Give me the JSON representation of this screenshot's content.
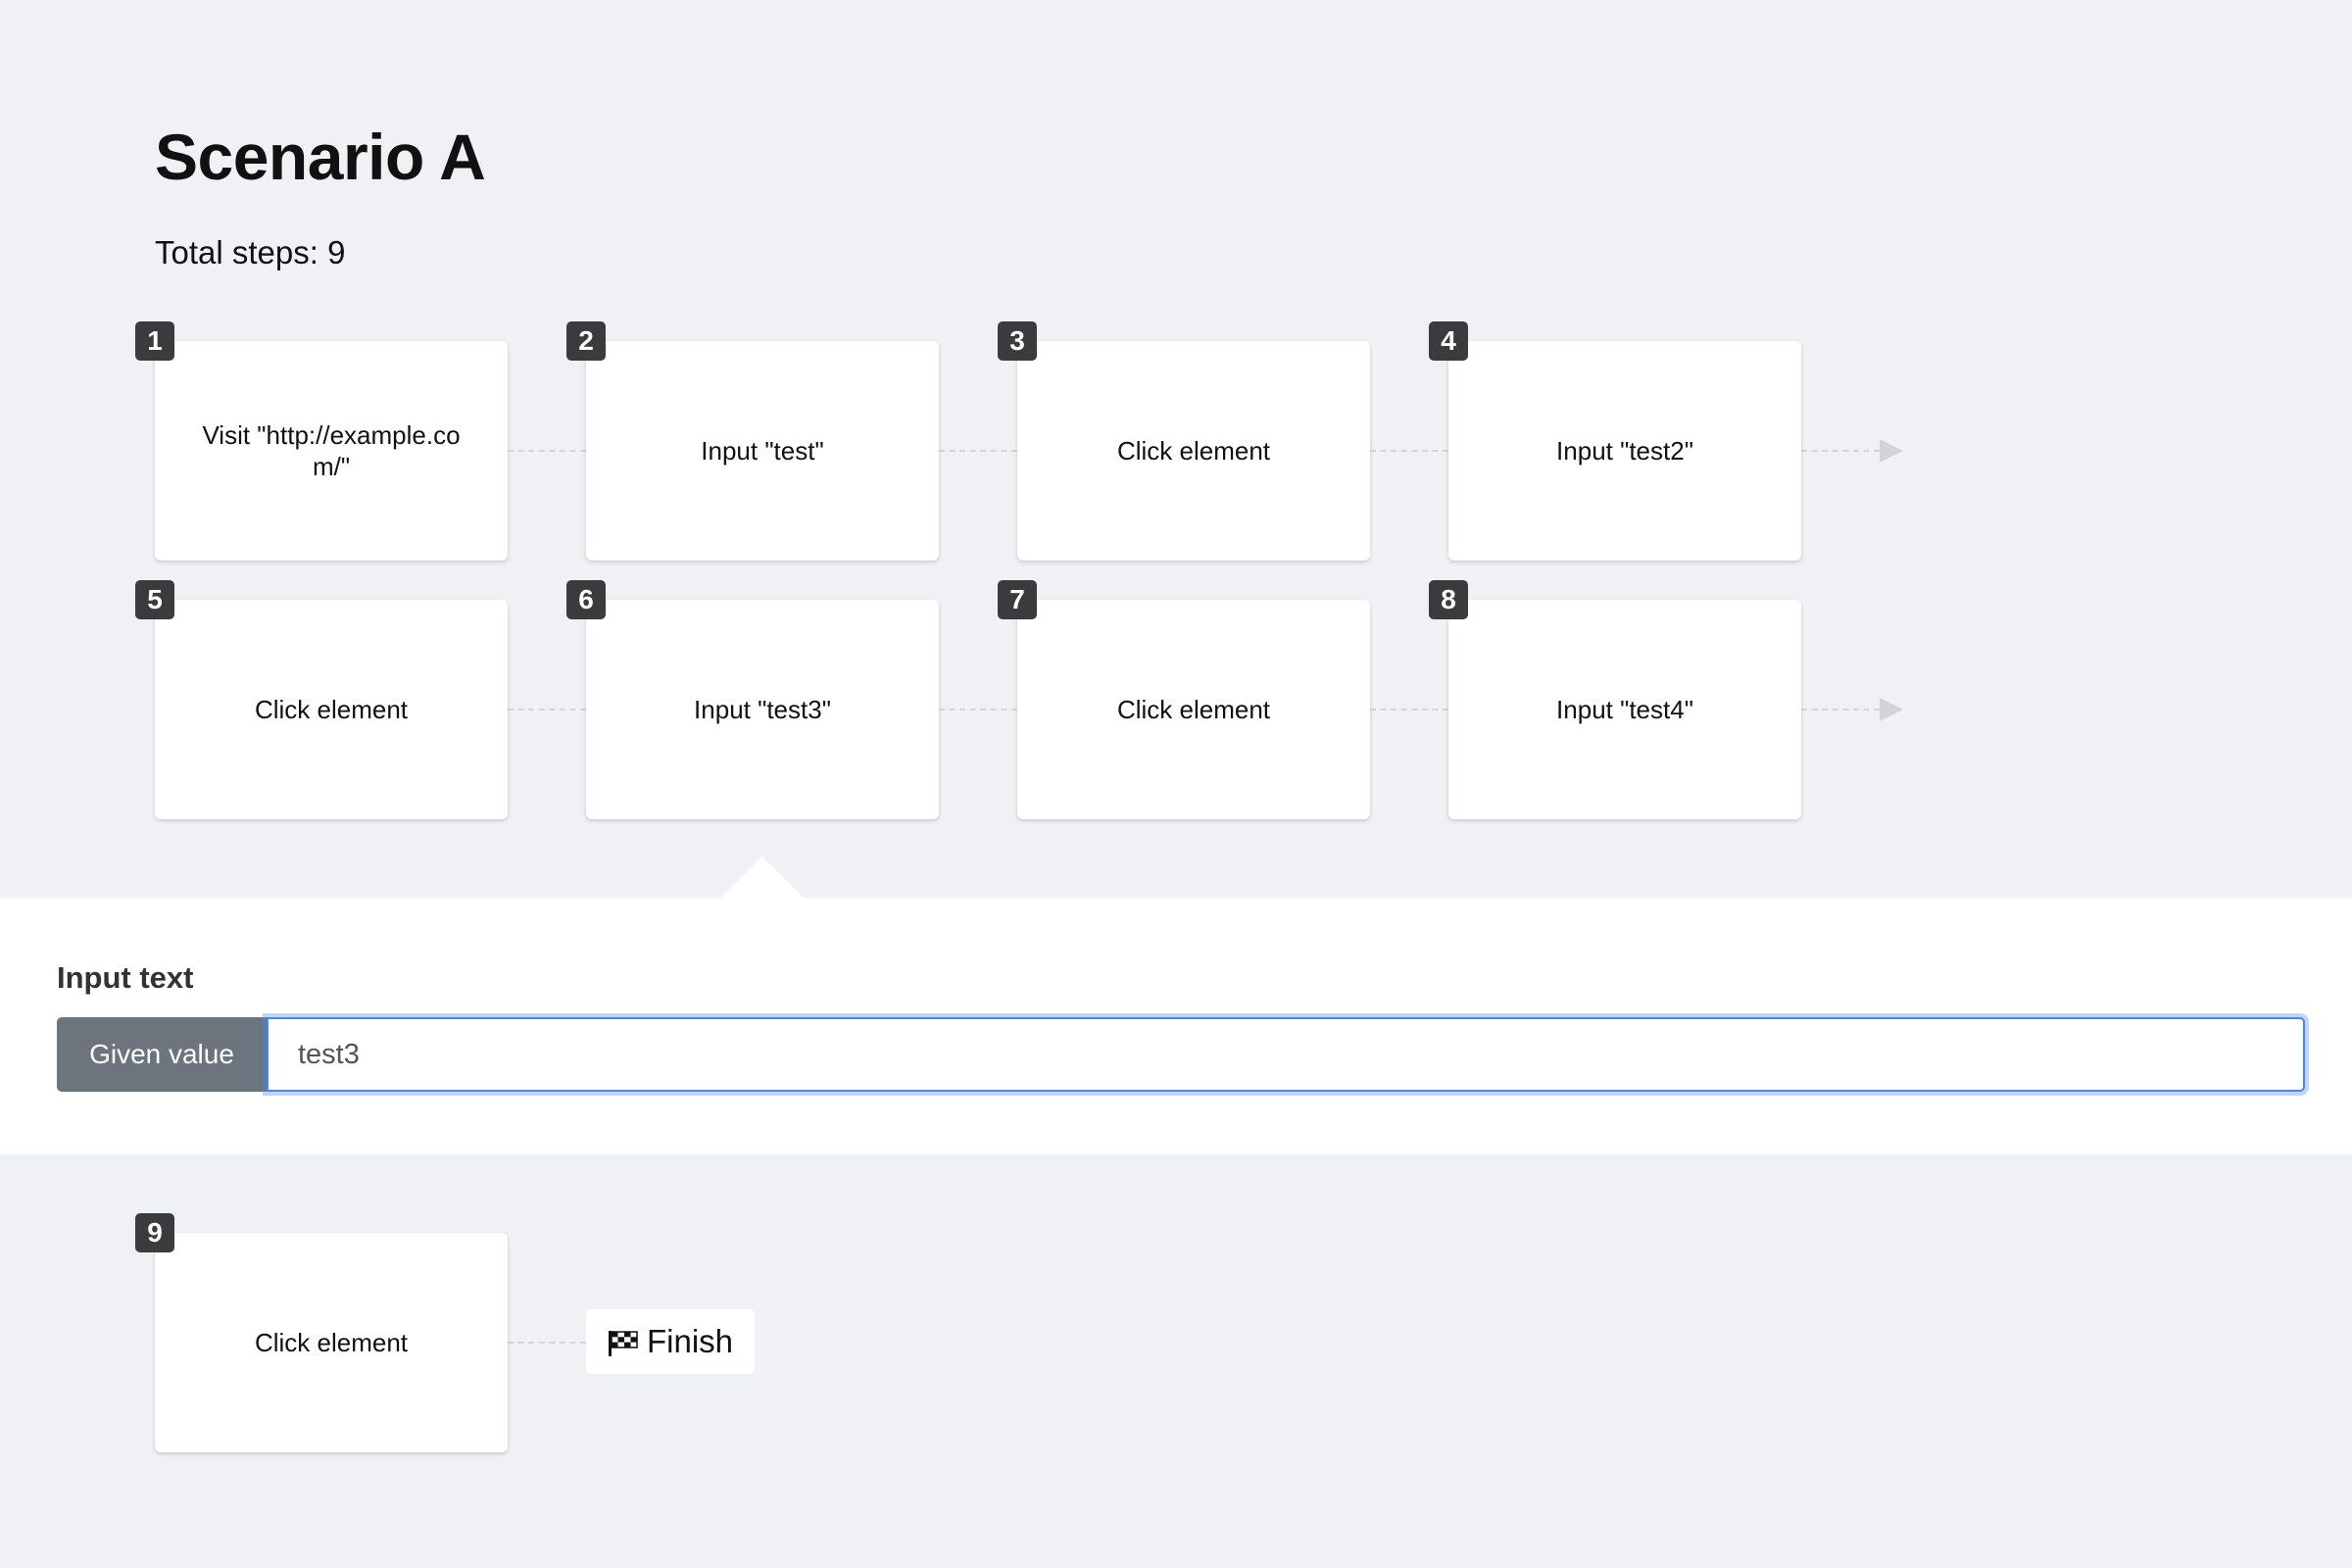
{
  "scenario": {
    "title": "Scenario A",
    "total_steps": "Total steps: 9"
  },
  "steps": [
    {
      "number": "1",
      "label": "Visit \"http://example.com/\""
    },
    {
      "number": "2",
      "label": "Input \"test\""
    },
    {
      "number": "3",
      "label": "Click element"
    },
    {
      "number": "4",
      "label": "Input \"test2\""
    },
    {
      "number": "5",
      "label": "Click element"
    },
    {
      "number": "6",
      "label": "Input \"test3\""
    },
    {
      "number": "7",
      "label": "Click element"
    },
    {
      "number": "8",
      "label": "Input \"test4\""
    },
    {
      "number": "9",
      "label": "Click element"
    }
  ],
  "detail_panel": {
    "label": "Input text",
    "addon_label": "Given value",
    "input_value": "test3"
  },
  "finish": {
    "label": "Finish",
    "icon": "checkered-flag-icon"
  },
  "colors": {
    "background": "#f0f1f5",
    "badge": "#3b3b3d",
    "addon": "#6c757d",
    "focus": "#4a86e8"
  }
}
